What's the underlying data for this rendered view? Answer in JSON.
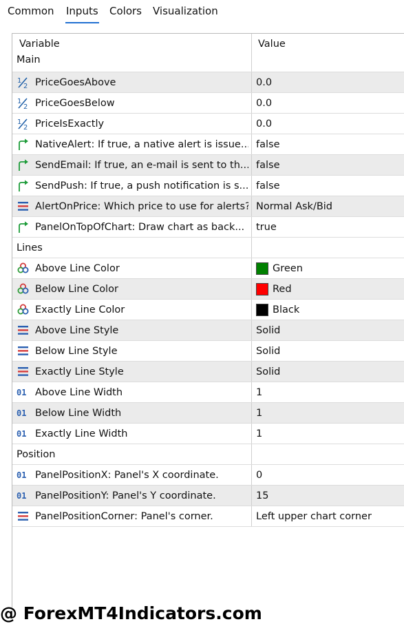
{
  "tabs": [
    {
      "label": "Common",
      "active": false
    },
    {
      "label": "Inputs",
      "active": true
    },
    {
      "label": "Colors",
      "active": false
    },
    {
      "label": "Visualization",
      "active": false
    }
  ],
  "columns": {
    "variable": "Variable",
    "value": "Value"
  },
  "groups": {
    "main": "Main",
    "lines": "Lines",
    "position": "Position"
  },
  "rows": [
    {
      "icon": "fraction-half-icon",
      "variable": "PriceGoesAbove",
      "value": "0.0"
    },
    {
      "icon": "fraction-half-icon",
      "variable": "PriceGoesBelow",
      "value": "0.0"
    },
    {
      "icon": "fraction-half-icon",
      "variable": "PriceIsExactly",
      "value": "0.0"
    },
    {
      "icon": "bool-arrow-icon",
      "variable": "NativeAlert: If true, a native alert is issue...",
      "value": "false"
    },
    {
      "icon": "bool-arrow-icon",
      "variable": "SendEmail: If true, an e-mail is sent to th...",
      "value": "false"
    },
    {
      "icon": "bool-arrow-icon",
      "variable": "SendPush: If true, a push notification is s...",
      "value": "false"
    },
    {
      "icon": "enum-list-icon",
      "variable": "AlertOnPrice: Which price to use for alerts?",
      "value": "Normal Ask/Bid"
    },
    {
      "icon": "bool-arrow-icon",
      "variable": "PanelOnTopOfChart: Draw chart as back...",
      "value": "true"
    },
    {
      "icon": "color-circles-icon",
      "variable": "Above Line Color",
      "value": "Green",
      "swatch": "#008000"
    },
    {
      "icon": "color-circles-icon",
      "variable": "Below Line Color",
      "value": "Red",
      "swatch": "#ff0000"
    },
    {
      "icon": "color-circles-icon",
      "variable": "Exactly Line Color",
      "value": "Black",
      "swatch": "#000000"
    },
    {
      "icon": "enum-list-icon",
      "variable": "Above Line Style",
      "value": "Solid"
    },
    {
      "icon": "enum-list-icon",
      "variable": "Below Line Style",
      "value": "Solid"
    },
    {
      "icon": "enum-list-icon",
      "variable": "Exactly Line Style",
      "value": "Solid"
    },
    {
      "icon": "integer-01-icon",
      "variable": "Above Line Width",
      "value": "1"
    },
    {
      "icon": "integer-01-icon",
      "variable": "Below Line Width",
      "value": "1"
    },
    {
      "icon": "integer-01-icon",
      "variable": "Exactly Line Width",
      "value": "1"
    },
    {
      "icon": "integer-01-icon",
      "variable": "PanelPositionX: Panel's X coordinate.",
      "value": "0"
    },
    {
      "icon": "integer-01-icon",
      "variable": "PanelPositionY: Panel's Y coordinate.",
      "value": "15"
    },
    {
      "icon": "enum-list-icon",
      "variable": "PanelPositionCorner: Panel's corner.",
      "value": "Left upper chart corner"
    }
  ],
  "watermark": "@ ForexMT4Indicators.com",
  "colors": {
    "accent": "#1f6fd1",
    "row_alt": "#ebebeb"
  }
}
